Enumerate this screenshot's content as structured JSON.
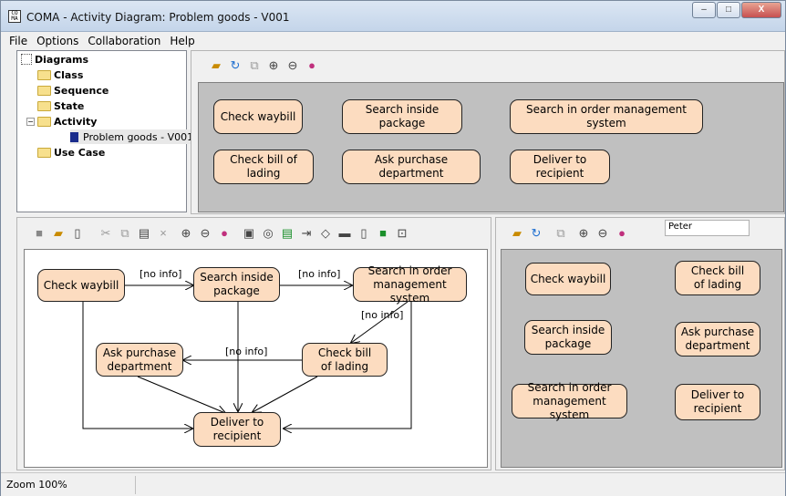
{
  "window": {
    "title": "COMA - Activity Diagram: Problem goods - V001",
    "app_icon": "CO MA",
    "minimize": "–",
    "maximize": "□",
    "close": "X"
  },
  "menu": [
    "File",
    "Options",
    "Collaboration",
    "Help"
  ],
  "tree": {
    "root": "Diagrams",
    "items": [
      "Class",
      "Sequence",
      "State",
      "Activity",
      "Use Case"
    ],
    "expander": "−",
    "activity_child": "Problem goods - V001"
  },
  "palette": {
    "nodes": [
      "Check waybill",
      "Search inside package",
      "Search in order management system",
      "Check bill of lading",
      "Ask purchase department",
      "Deliver to recipient"
    ]
  },
  "main_diagram": {
    "nodes": {
      "check_waybill": "Check waybill",
      "search_package_1": "Search inside",
      "search_package_2": "package",
      "search_oms_1": "Search in order",
      "search_oms_2": "management system",
      "check_bill_1": "Check bill",
      "check_bill_2": "of lading",
      "ask_purchase_1": "Ask purchase",
      "ask_purchase_2": "department",
      "deliver_1": "Deliver to",
      "deliver_2": "recipient"
    },
    "labels": {
      "e1": "[no info]",
      "e2": "[no info]",
      "e3": "[no info]",
      "e4": "[no info]"
    }
  },
  "right_diagram": {
    "user": "Peter",
    "nodes": {
      "check_waybill": "Check waybill",
      "search_package_1": "Search inside",
      "search_package_2": "package",
      "search_oms_1": "Search in order",
      "search_oms_2": "management system",
      "check_bill_1": "Check bill",
      "check_bill_2": "of lading",
      "ask_purchase_1": "Ask purchase",
      "ask_purchase_2": "department",
      "deliver_1": "Deliver to",
      "deliver_2": "recipient"
    }
  },
  "status": {
    "zoom": "Zoom 100%"
  },
  "colors": {
    "node_fill": "#fcdcc0",
    "canvas_gray": "#c0c0c0"
  }
}
